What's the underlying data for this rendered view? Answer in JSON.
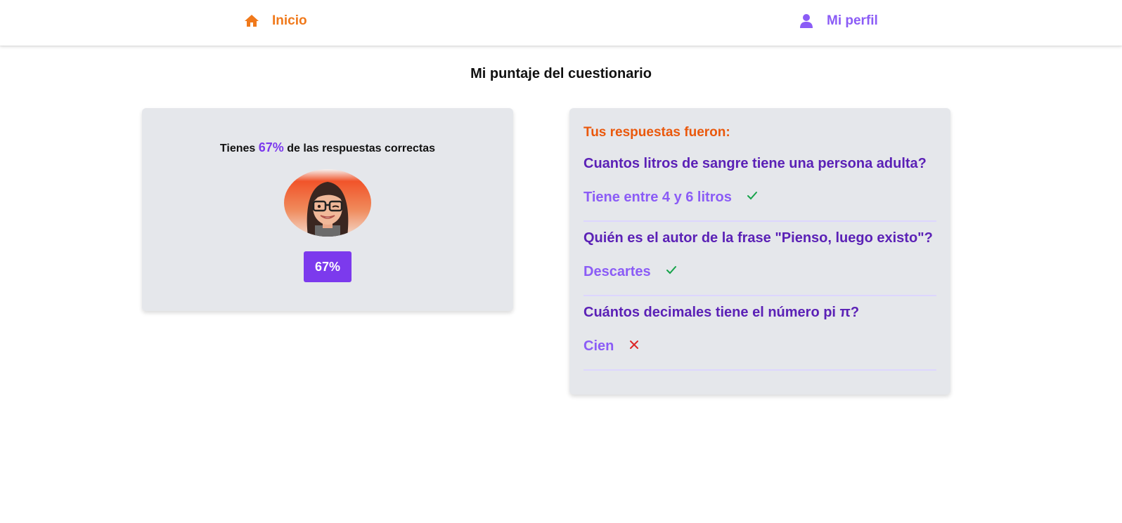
{
  "nav": {
    "home_label": "Inicio",
    "home_icon": "home-icon",
    "profile_label": "Mi perfil",
    "profile_icon": "user-icon",
    "home_color": "#f0791b",
    "profile_color": "#8b5cf6"
  },
  "page": {
    "title": "Mi puntaje del cuestionario"
  },
  "score": {
    "prefix": "Tienes",
    "percent": "67%",
    "suffix": "de las respuestas correctas",
    "badge": "67%",
    "avatar_icon": "avatar"
  },
  "answers": {
    "heading": "Tus respuestas fueron:",
    "items": [
      {
        "question": "Cuantos litros de sangre tiene una persona adulta?",
        "answer": "Tiene entre 4 y 6 litros",
        "result_icon": "check-icon",
        "correct": true
      },
      {
        "question": "Quién es el autor de la frase \"Pienso, luego existo\"?",
        "answer": "Descartes",
        "result_icon": "check-icon",
        "correct": true
      },
      {
        "question": "Cuántos decimales tiene el número pi π?",
        "answer": "Cien",
        "result_icon": "x-icon",
        "correct": false
      }
    ]
  },
  "colors": {
    "accent_purple": "#7c3aed",
    "accent_orange": "#ea580c",
    "card_bg": "#e5e7eb",
    "correct_green": "#16a34a",
    "wrong_red": "#dc2626"
  }
}
